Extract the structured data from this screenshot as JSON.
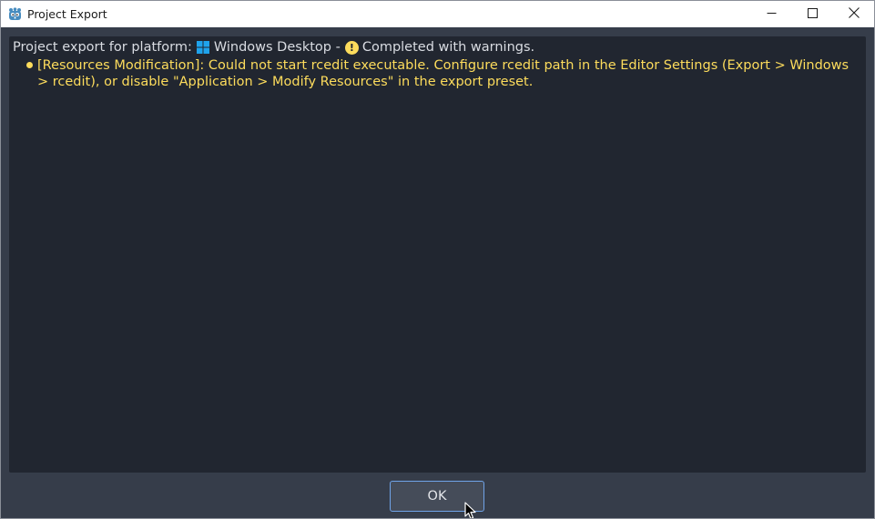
{
  "window": {
    "title": "Project Export",
    "app_icon": "godot-icon"
  },
  "caption_buttons": {
    "minimize": "minimize-icon",
    "maximize": "maximize-icon",
    "close": "close-icon"
  },
  "log": {
    "header_prefix": "Project export for platform:",
    "platform_name": "Windows Desktop -",
    "status_text": "Completed with warnings.",
    "warning_icon_glyph": "!",
    "messages": [
      {
        "type": "warning",
        "text": "[Resources Modification]: Could not start rcedit executable. Configure rcedit path in the Editor Settings (Export > Windows > rcedit), or disable \"Application > Modify Resources\" in the export preset."
      }
    ]
  },
  "footer": {
    "ok_label": "OK"
  },
  "colors": {
    "warning": "#fddc5c",
    "panel_bg": "#212630",
    "window_bg": "#363d4a",
    "accent": "#6fa3e8",
    "windows_blue": "#1fa3ec"
  }
}
